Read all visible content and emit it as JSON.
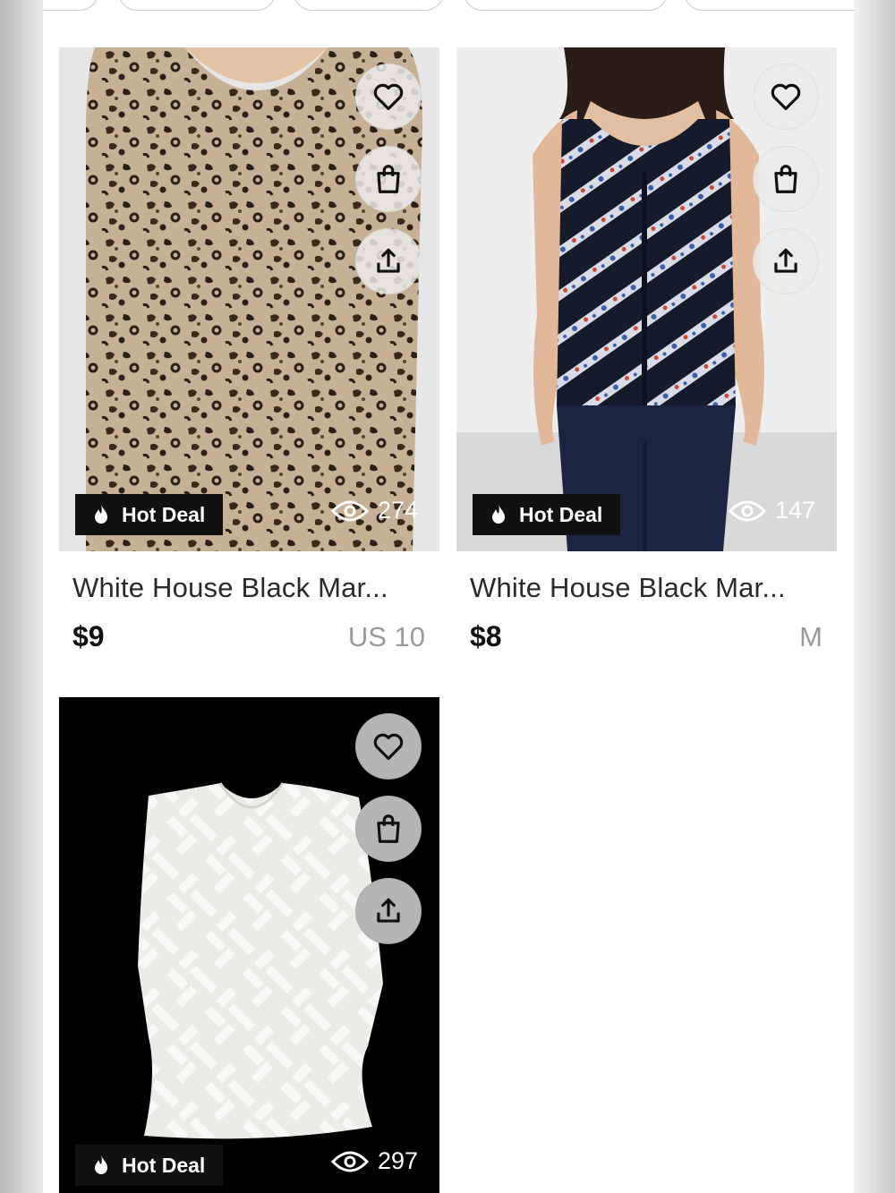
{
  "icons": {
    "favorite": "heart-icon",
    "bag": "shopping-bag-icon",
    "share": "share-icon",
    "flame": "flame-icon",
    "views": "eye-icon"
  },
  "listings": [
    {
      "badge": "Hot Deal",
      "views": "274",
      "title": "White House Black Mar...",
      "price": "$9",
      "size": "US 10",
      "image_desc": "leopard print long-sleeve blouse"
    },
    {
      "badge": "Hot Deal",
      "views": "147",
      "title": "White House Black Mar...",
      "price": "$8",
      "size": "M",
      "image_desc": "navy sleeveless patterned top on model"
    },
    {
      "badge": "Hot Deal",
      "views": "297",
      "title": "",
      "price": "",
      "size": "",
      "image_desc": "white geometric jacquard blouse on black background"
    }
  ],
  "colors": {
    "badge_bg": "#111111",
    "price": "#111111",
    "size": "#9a9a9a"
  }
}
